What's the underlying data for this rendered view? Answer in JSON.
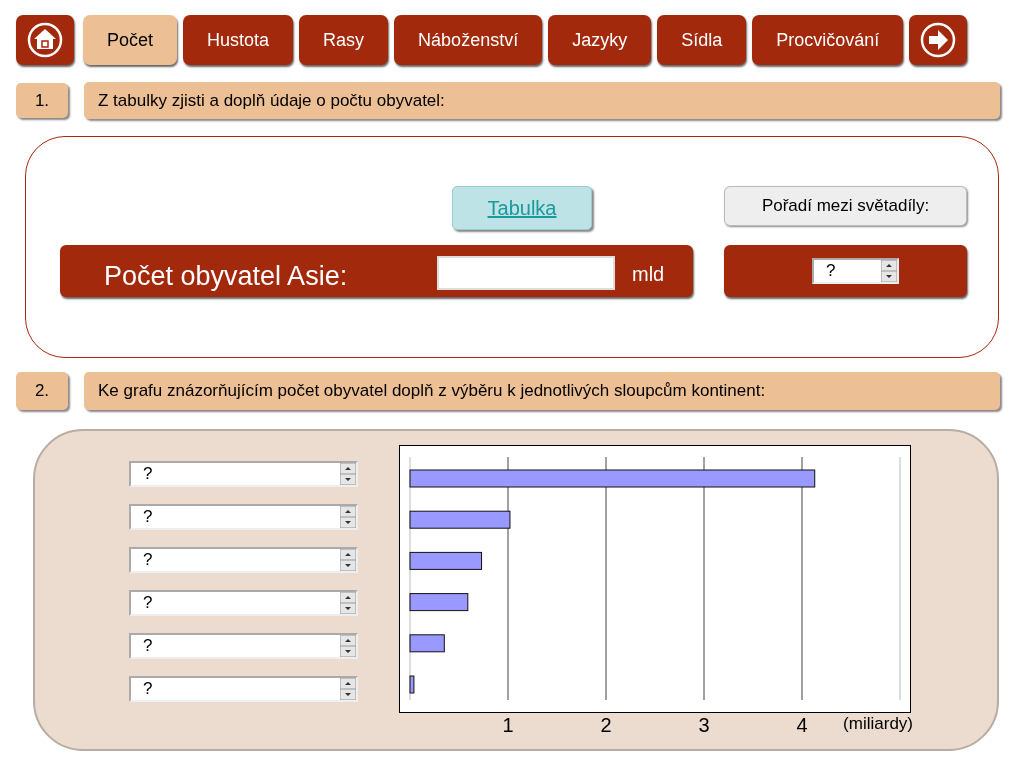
{
  "nav": [
    {
      "kind": "home"
    },
    {
      "kind": "tab",
      "label": "Počet",
      "selected": true
    },
    {
      "kind": "tab",
      "label": "Hustota",
      "selected": false
    },
    {
      "kind": "tab",
      "label": "Rasy",
      "selected": false
    },
    {
      "kind": "tab",
      "label": "Náboženství",
      "selected": false
    },
    {
      "kind": "tab",
      "label": "Jazyky",
      "selected": false
    },
    {
      "kind": "tab",
      "label": "Sídla",
      "selected": false
    },
    {
      "kind": "tab",
      "label": "Procvičování",
      "selected": false
    },
    {
      "kind": "next"
    }
  ],
  "task1": {
    "number": "1.",
    "instruction": "Z tabulky zjisti a doplň údaje o počtu obyvatel:",
    "table_link": "Tabulka",
    "rank_label": "Pořadí mezi světadíly:",
    "population_label": "Počet obyvatel Asie:",
    "unit": "mld",
    "rank_value": "?"
  },
  "task2": {
    "number": "2.",
    "instruction": "Ke grafu znázorňujícím počet obyvatel doplň z výběru k jednotlivých sloupcům kontinent:",
    "selects": [
      "?",
      "?",
      "?",
      "?",
      "?",
      "?"
    ],
    "chart_data": {
      "type": "bar",
      "orientation": "horizontal",
      "xlabel": "(miliardy)",
      "values": [
        4.13,
        1.02,
        0.73,
        0.59,
        0.35,
        0.04
      ],
      "xlim": [
        0,
        5
      ],
      "xticks": [
        1,
        2,
        3,
        4
      ],
      "grid": true
    }
  }
}
